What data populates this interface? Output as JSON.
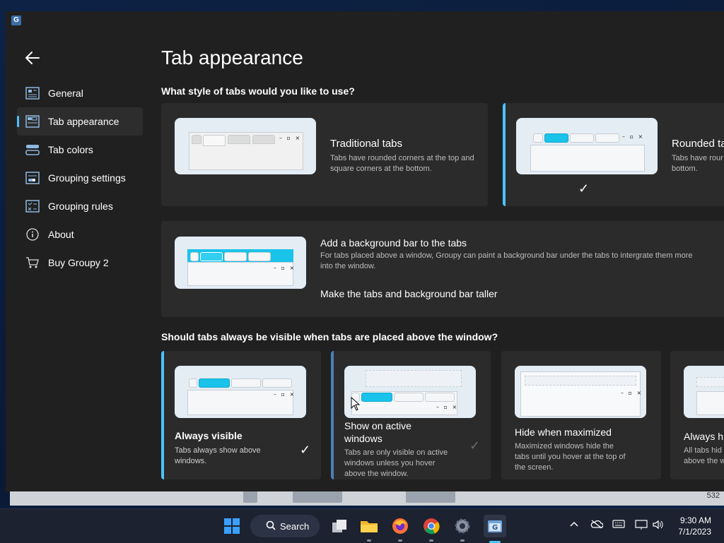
{
  "app": {
    "nav": [
      {
        "label": "General",
        "icon": "general-icon"
      },
      {
        "label": "Tab appearance",
        "icon": "tab-appearance-icon"
      },
      {
        "label": "Tab colors",
        "icon": "tab-colors-icon"
      },
      {
        "label": "Grouping settings",
        "icon": "grouping-settings-icon"
      },
      {
        "label": "Grouping rules",
        "icon": "grouping-rules-icon"
      },
      {
        "label": "About",
        "icon": "info-icon"
      },
      {
        "label": "Buy Groupy 2",
        "icon": "cart-icon"
      }
    ],
    "active_nav": "Tab appearance",
    "accent": "#4cc2ff"
  },
  "page": {
    "title": "Tab appearance",
    "style_question": "What style of tabs would you like to use?",
    "style_options": [
      {
        "title": "Traditional tabs",
        "desc": "Tabs have rounded corners at the top and square corners at the bottom.",
        "selected": false
      },
      {
        "title": "Rounded ta",
        "desc": "Tabs have rour and bottom.",
        "selected": true
      }
    ],
    "background_bar": {
      "title": "Add a background bar to the tabs",
      "desc": "For tabs placed above a window, Groupy can paint a background bar under the tabs to intergrate them more into the window.",
      "taller_label": "Make the tabs and background bar taller"
    },
    "visibility_question": "Should tabs always be visible when tabs are placed above the window?",
    "visibility_options": [
      {
        "title": "Always visible",
        "desc": "Tabs always show above windows.",
        "selected": true
      },
      {
        "title": "Show on active windows",
        "desc": "Tabs are only visible on active windows unless you hover above the window.",
        "selected": false
      },
      {
        "title": "Hide when maximized",
        "desc": "Maximized windows hide the tabs until you hover at the top of the screen.",
        "selected": false
      },
      {
        "title": "Always h",
        "desc": "All tabs hid above the w",
        "selected": false
      }
    ],
    "window_controls": "– ▫ ×"
  },
  "taskbar": {
    "search_label": "Search",
    "time": "9:30 AM",
    "date": "7/1/2023",
    "bg_number": "532"
  }
}
